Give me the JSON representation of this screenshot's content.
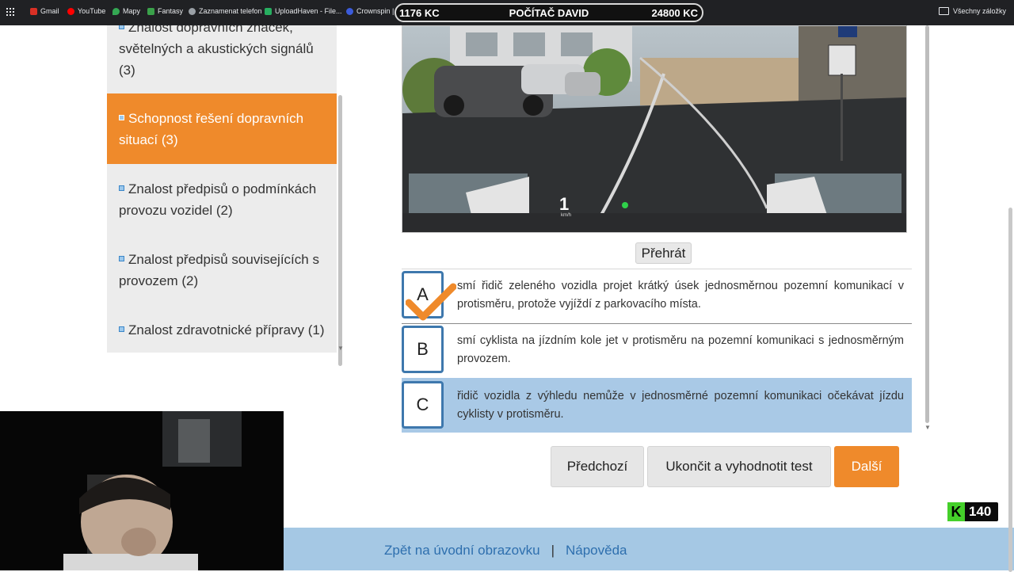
{
  "bookmarks_bar": {
    "items": [
      {
        "label": "Gmail",
        "color": "#d93025"
      },
      {
        "label": "YouTube",
        "color": "#ff0000"
      },
      {
        "label": "Mapy",
        "color": "#34a853"
      },
      {
        "label": "Fantasy",
        "color": "#3aa14a"
      },
      {
        "label": "Zaznamenat telefon",
        "color": "#9aa0a6"
      },
      {
        "label": "UploadHaven - File...",
        "color": "#27ae60"
      },
      {
        "label": "Crownspin | ",
        "color": "#3b5bdb"
      }
    ],
    "folder_label": "Všechny záložky"
  },
  "overlay": {
    "left_value": "1176 KC",
    "center_label": "POČÍTAČ DAVID",
    "right_value": "24800 KC"
  },
  "menu": {
    "items": [
      {
        "label": "Znalost dopravních značek, světelných a akustických signálů (3)",
        "active": false
      },
      {
        "label": "Schopnost řešení dopravních situací (3)",
        "active": true
      },
      {
        "label": "Znalost předpisů o podmínkách provozu vozidel (2)",
        "active": false
      },
      {
        "label": "Znalost předpisů souvisejících s provozem (2)",
        "active": false
      },
      {
        "label": "Znalost zdravotnické přípravy (1)",
        "active": false
      }
    ]
  },
  "video": {
    "speed_value": "1",
    "speed_unit": "km/h"
  },
  "play_button": "Přehrát",
  "answers": [
    {
      "letter": "A",
      "text": "smí řidič zeleného vozidla projet krátký úsek jednosměrnou pozemní komunikací v protisměru, protože vyjíždí z parkovacího místa.",
      "checked": true,
      "selected": false
    },
    {
      "letter": "B",
      "text": "smí cyklista na jízdním kole jet v protisměru na pozemní komunikaci s jednosměrným provozem.",
      "checked": false,
      "selected": false
    },
    {
      "letter": "C",
      "text": "řidič vozidla z výhledu nemůže v jednosměrné pozemní komunikaci očekávat jízdu cyklisty v protisměru.",
      "checked": false,
      "selected": true
    }
  ],
  "nav": {
    "prev": "Předchozí",
    "finish": "Ukončit a vyhodnotit test",
    "next": "Další"
  },
  "footer": {
    "home_link": "Zpět na úvodní obrazovku",
    "separator": "|",
    "help_link": "Nápověda"
  },
  "badge": {
    "letter": "K",
    "value": "140"
  },
  "colors": {
    "accent_orange": "#ef8a2b",
    "selected_blue": "#a9c9e6",
    "footer_blue": "#a5c8e4",
    "letter_border": "#3e78ad",
    "link_blue": "#2e6fae"
  }
}
